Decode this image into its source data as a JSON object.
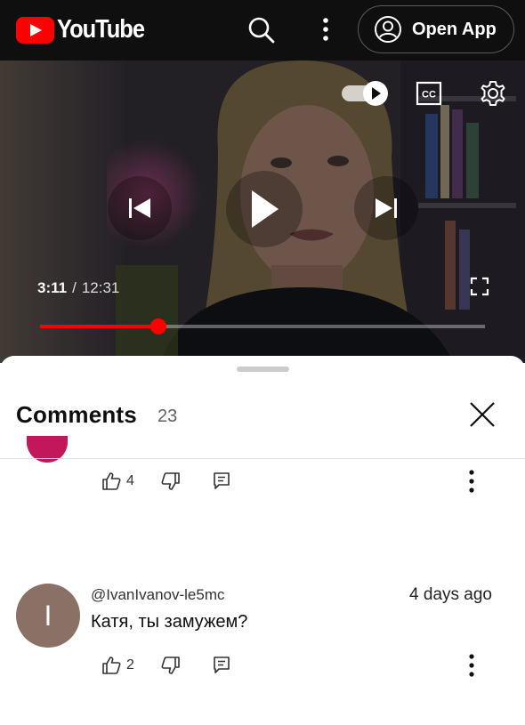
{
  "topbar": {
    "logo_text": "YouTube",
    "search_icon": "search-icon",
    "more_icon": "more-vertical-icon",
    "open_app_label": "Open App",
    "account_icon": "account-circle-icon"
  },
  "player": {
    "current_time": "3:11",
    "separator": "/",
    "duration": "12:31",
    "progress_fraction": 0.265,
    "autoplay_on": true,
    "icons": [
      "autoplay-toggle-icon",
      "captions-icon",
      "settings-gear-icon",
      "previous-icon",
      "play-icon",
      "next-icon",
      "fullscreen-icon"
    ]
  },
  "comments_panel": {
    "title": "Comments",
    "count": "23",
    "close_icon": "close-icon",
    "comments": [
      {
        "likes": "4",
        "avatar_color": "#c2185b"
      },
      {
        "author": "@IvanIvanov-le5mc",
        "time_ago": "4 days ago",
        "text": "Катя, ты замужем?",
        "avatar_letter": "I",
        "avatar_color": "#8b7065",
        "likes": "2"
      }
    ]
  },
  "colors": {
    "brand_red": "#ff0000",
    "topbar_bg": "#0f0f0f",
    "muted_text": "#606060"
  }
}
